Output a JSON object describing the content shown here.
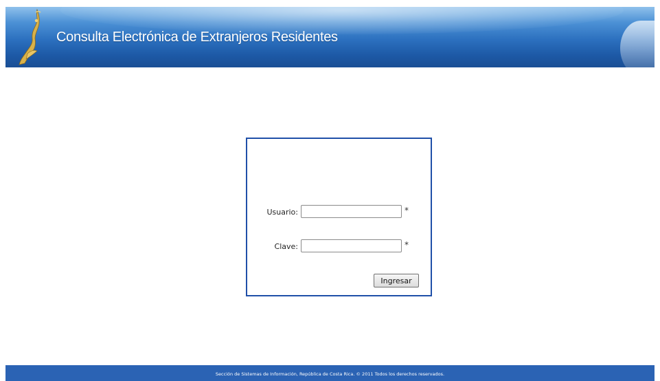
{
  "header": {
    "title": "Consulta Electrónica de Extranjeros Residentes",
    "logo_icon": "golden-statue-logo-icon"
  },
  "login": {
    "username_label": "Usuario:",
    "username_value": "",
    "username_required": "*",
    "password_label": "Clave:",
    "password_value": "",
    "password_required": "*",
    "submit_label": "Ingresar"
  },
  "footer": {
    "text": "Sección de Sistemas de Información, República de Costa Rica. © 2011 Todos los derechos reservados."
  },
  "colors": {
    "header_blue": "#2b6fbe",
    "box_border": "#1f4fa8",
    "footer_blue": "#2b63b4"
  }
}
